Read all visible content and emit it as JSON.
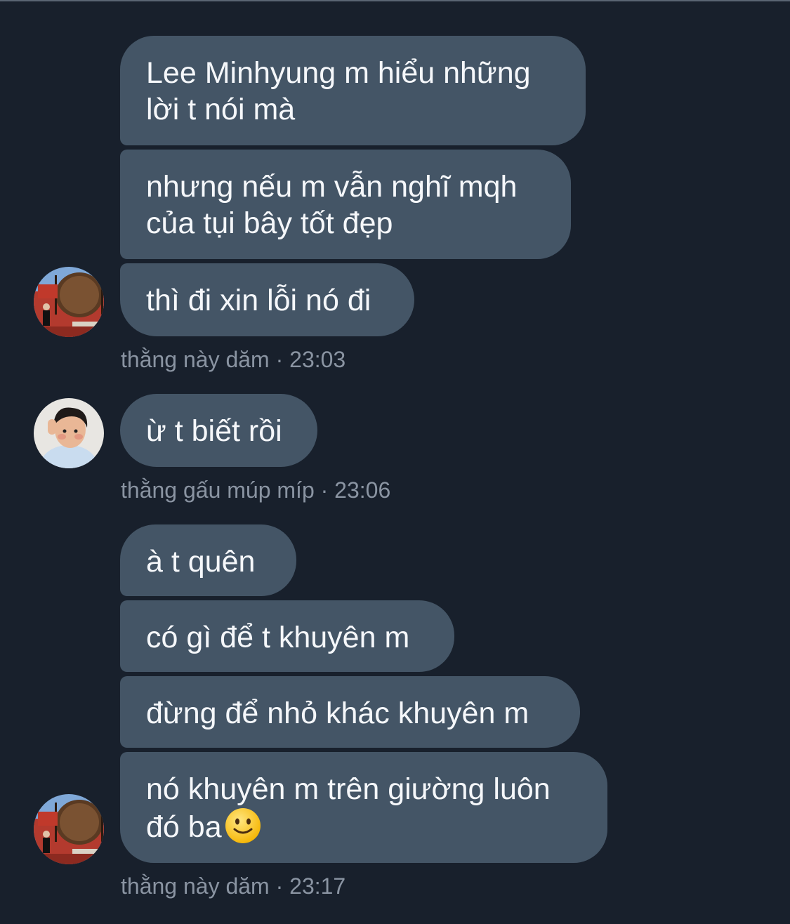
{
  "messages": [
    {
      "text": "Lee Minhyung m hiểu những lời t nói mà"
    },
    {
      "text": "nhưng nếu m vẫn nghĩ mqh của tụi bây tốt đẹp"
    },
    {
      "text": "thì đi xin lỗi nó đi"
    },
    {
      "text": "ừ t biết rồi"
    },
    {
      "text": "à t quên"
    },
    {
      "text": "có gì để t khuyên m"
    },
    {
      "text": "đừng để nhỏ khác khuyên m"
    },
    {
      "text": "nó khuyên m trên giường luôn đó ba",
      "emoji": "slightly-smiling-face-emoji"
    }
  ],
  "groups": [
    {
      "sender": "thằng này dăm",
      "separator": "·",
      "time": "23:03"
    },
    {
      "sender": "thằng gấu múp míp",
      "separator": "·",
      "time": "23:06"
    },
    {
      "sender": "thằng này dăm",
      "separator": "·",
      "time": "23:17"
    }
  ],
  "colors": {
    "background": "#18202c",
    "bubble": "#445566",
    "text": "#f5f7fa",
    "meta": "#8a94a2"
  }
}
